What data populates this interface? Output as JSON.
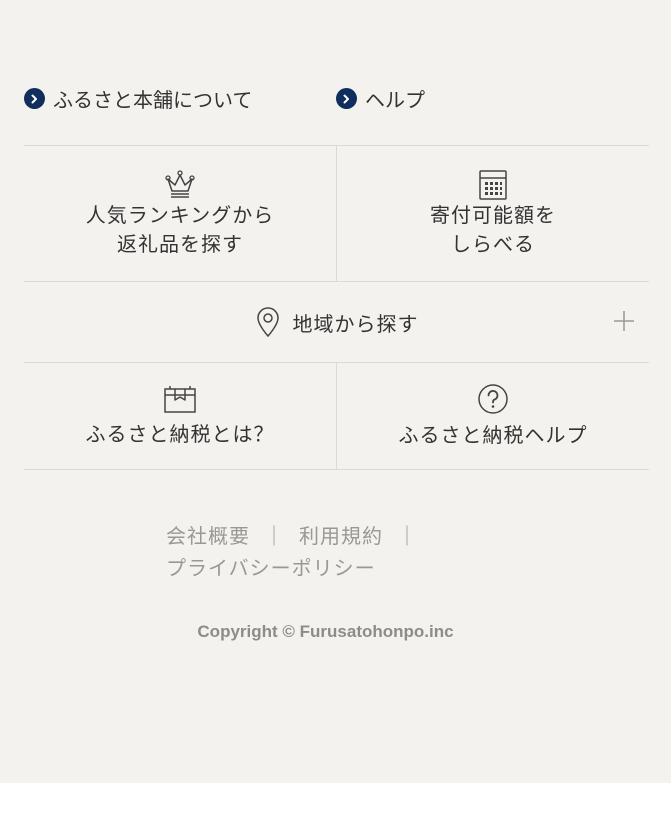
{
  "top_links": [
    {
      "label": "ふるさと本舗について",
      "icon": "chevron-right-icon"
    },
    {
      "label": "ヘルプ",
      "icon": "chevron-right-icon"
    }
  ],
  "menu": {
    "ranking": {
      "line1": "人気ランキングから",
      "line2": "返礼品を探す",
      "icon": "crown-icon"
    },
    "simulator": {
      "line1": "寄付可能額を",
      "line2": "しらべる",
      "icon": "calculator-icon"
    },
    "region": {
      "label": "地域から探す",
      "icon": "map-pin-icon",
      "expand_icon": "plus-icon"
    },
    "about": {
      "label": "ふるさと納税とは？",
      "icon": "box-icon"
    },
    "help": {
      "label": "ふるさと納税ヘルプ",
      "icon": "question-circle-icon"
    }
  },
  "legal": {
    "company": "会社概要",
    "separator": "｜",
    "terms": "利用規約",
    "privacy": "プライバシーポリシー"
  },
  "copyright": "Copyright © Furusatohonpo.inc",
  "colors": {
    "background": "#f3f2ef",
    "accent": "#0f2e5c",
    "divider": "#dcdad6",
    "muted": "#9a9894"
  }
}
